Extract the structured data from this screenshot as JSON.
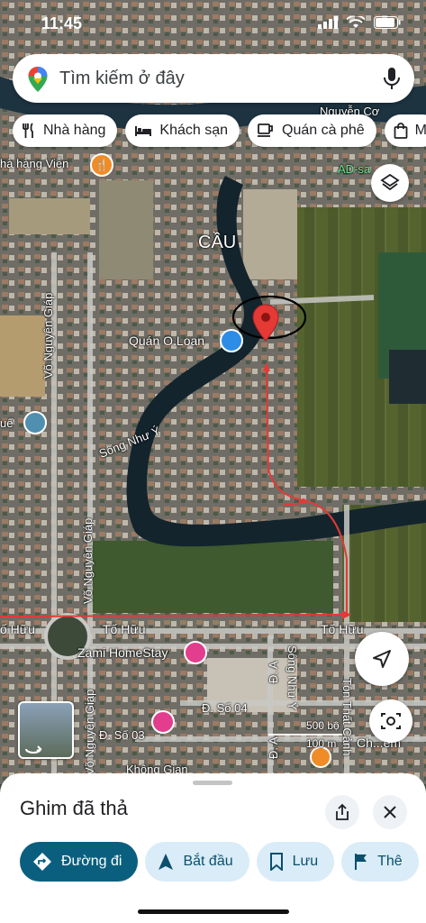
{
  "status_bar": {
    "time": "11:45"
  },
  "search": {
    "placeholder": "Tìm kiếm ở đây"
  },
  "chips": [
    {
      "label": "Nhà hàng",
      "icon": "fork-knife-icon"
    },
    {
      "label": "Khách sạn",
      "icon": "bed-icon"
    },
    {
      "label": "Quán cà phê",
      "icon": "coffee-cup-icon"
    },
    {
      "label": "M",
      "icon": "shopping-bag-icon"
    }
  ],
  "map_labels": {
    "restaurant": "hà hàng Viễn",
    "nguyen": "Nguyễn Cơ",
    "ad": "AD-sa",
    "cau": "CẦU",
    "quan": "Quán O.Loan",
    "hue": "uế",
    "song_nhu_y": "Sông Như Ý",
    "vo_nguyen_giap_1": "Võ Nguyên Giáp",
    "vo_nguyen_giap_2": "Võ Nguyên Giáp",
    "vo_nguyen_giap_3": "Võ Nguyên Giáp",
    "to_huu_1": "ố Hữu",
    "to_huu_2": "Tố Hữu",
    "to_huu_3": "Tố Hữu",
    "to_huu_4": "Tôn Thất Cảnh",
    "zami": "Zami HomeStay",
    "so04": "Đ. Số 04",
    "so03": "Đ. Số 03",
    "da1": "Đ. A",
    "da2": "Đ. A",
    "song_nhu_y_2": "Sông Như Ý",
    "khong_gian": "Không Gian",
    "scale_ft": "500 bộ",
    "scale_m": "100 m",
    "ch_em": "Ch...em"
  },
  "sheet": {
    "title": "Ghim đã thả",
    "actions": [
      {
        "label": "Đường đi",
        "icon": "directions-icon"
      },
      {
        "label": "Bắt đầu",
        "icon": "navigation-arrow-icon"
      },
      {
        "label": "Lưu",
        "icon": "bookmark-icon"
      },
      {
        "label": "Thê",
        "icon": "flag-icon"
      }
    ]
  },
  "colors": {
    "accent": "#0b5f7e",
    "pin": "#e53935",
    "route": "#e53935"
  }
}
